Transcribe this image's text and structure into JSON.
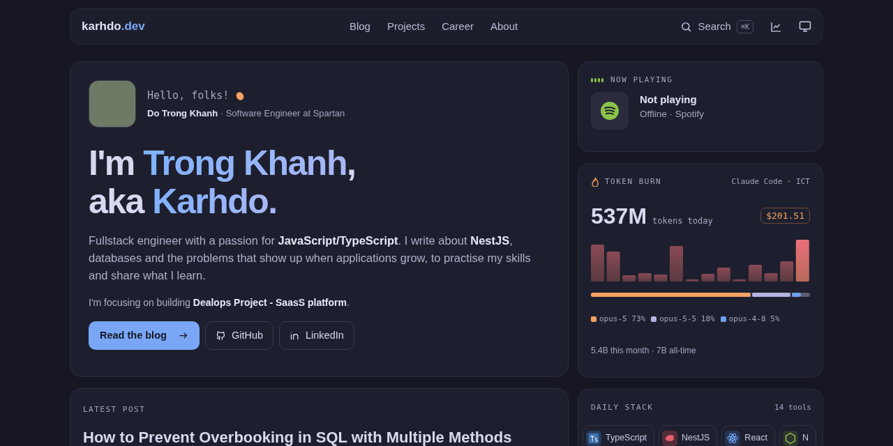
{
  "navbar": {
    "logo": {
      "main": "karhdo",
      "accent": ".dev"
    },
    "links": [
      "Blog",
      "Projects",
      "Career",
      "About"
    ],
    "search": {
      "label": "Search",
      "shortcut": "⌘K"
    }
  },
  "hero": {
    "greeting": "Hello, folks!",
    "name": "Do Trong Khanh",
    "role": "· Software Engineer at Spartan",
    "headline": [
      [
        {
          "text": "I'm ",
          "highlight": false
        },
        {
          "text": "Trong Khanh",
          "highlight": true
        },
        {
          "text": ",",
          "highlight": false
        }
      ],
      [
        {
          "text": "aka ",
          "highlight": false
        },
        {
          "text": "Karhdo.",
          "highlight": true
        }
      ]
    ],
    "bio": "Fullstack engineer with a passion for **JavaScript/TypeScript**. I write about **NestJS**, databases and the problems that show up when applications grow, to practise my skills and share what I learn.",
    "focus": "I'm focusing on building **Dealops Project - SaasS platform**.",
    "buttons": [
      {
        "label": "Read the blog",
        "kind": "primary"
      },
      {
        "label": "GitHub",
        "kind": "github"
      },
      {
        "label": "LinkedIn",
        "kind": "linkedin"
      }
    ]
  },
  "now_playing": {
    "title": "NOW PLAYING",
    "track": "Not playing",
    "status": "Offline · Spotify"
  },
  "token_burn": {
    "title": "TOKEN BURN",
    "source": "Claude Code · ICT",
    "total": "537M",
    "unit": "tokens today",
    "cost": "$201.51",
    "models": [
      {
        "name": "opus-5",
        "share": "73%",
        "color": "#f4a261"
      },
      {
        "name": "opus-5-5",
        "share": "18%",
        "color": "#b4b4e0"
      },
      {
        "name": "opus-4-8",
        "share": "5%",
        "color": "#6ea0f0"
      }
    ],
    "footer": "5.4B this month · 7B all-time"
  },
  "latest_post": {
    "label": "LATEST POST",
    "title": "How to Prevent Overbooking in SQL with Multiple Methods"
  },
  "daily_stack": {
    "title": "DAILY STACK",
    "count": "14 tools",
    "tools": [
      {
        "name": "TypeScript",
        "kind": "ts"
      },
      {
        "name": "NestJS",
        "kind": "nest"
      },
      {
        "name": "React",
        "kind": "react"
      },
      {
        "name": "N",
        "kind": "node"
      }
    ]
  }
}
